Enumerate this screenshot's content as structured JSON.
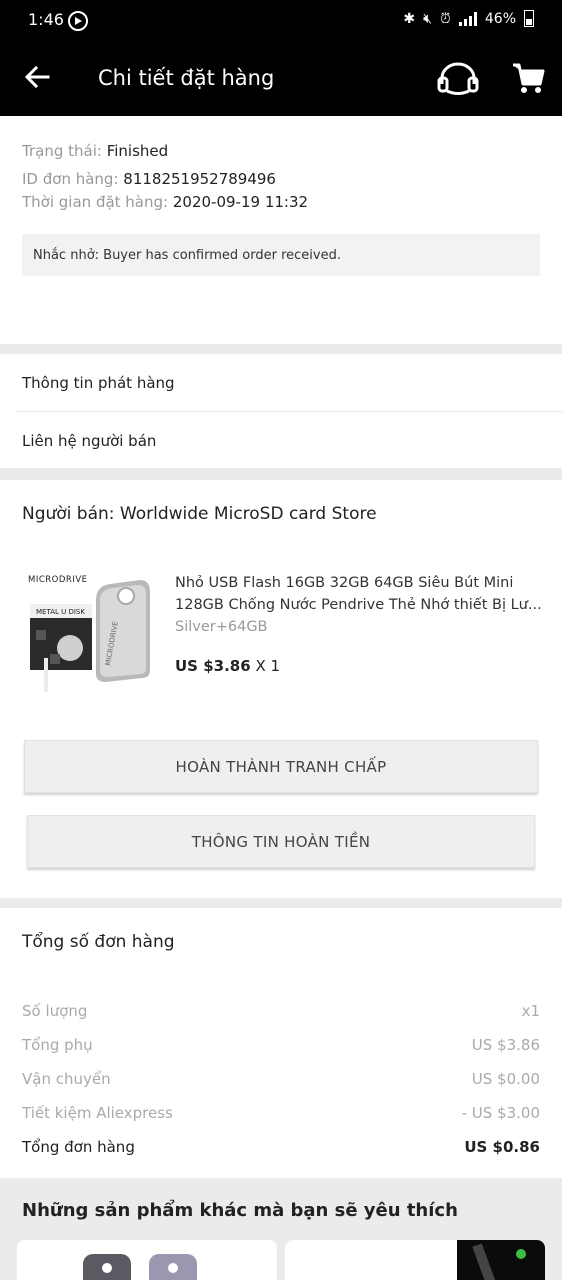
{
  "status_bar": {
    "time": "1:46",
    "battery": "46%"
  },
  "app_bar": {
    "title": "Chi tiết đặt hàng",
    "icons": [
      "back-arrow-icon",
      "headset-support-icon",
      "cart-icon"
    ]
  },
  "order": {
    "status_label": "Trạng thái:",
    "status_value": "Finished",
    "id_label": "ID đơn hàng:",
    "id_value": "8118251952789496",
    "time_label": "Thời gian đặt hàng:",
    "time_value": "2020-09-19 11:32",
    "notice": "Nhắc nhở: Buyer has confirmed order received."
  },
  "links": {
    "shipping_info": "Thông tin phát hàng",
    "contact_seller": "Liên hệ người bán"
  },
  "seller": {
    "label": "Người bán: Worldwide MicroSD card Store"
  },
  "product": {
    "title_line1": "Nhỏ USB Flash 16GB 32GB 64GB Siêu Bút Mini",
    "title_line2": "128GB Chống Nước Pendrive Thẻ Nhớ thiết Bị Lư...",
    "variant": "Silver+64GB",
    "price": "US $3.86",
    "quantity": "X 1",
    "image_brand": "MICRODRIVE",
    "image_caption": "METAL U DISK"
  },
  "buttons": {
    "dispute": "HOÀN THÀNH TRANH CHẤP",
    "refund_info": "THÔNG TIN HOÀN TIỀN"
  },
  "summary": {
    "title": "Tổng số đơn hàng",
    "rows": [
      {
        "label": "Số lượng",
        "value": "x1"
      },
      {
        "label": "Tổng phụ",
        "value": "US $3.86"
      },
      {
        "label": "Vận chuyển",
        "value": "US $0.00"
      },
      {
        "label": "Tiết kiệm Aliexpress",
        "value": "- US $3.00"
      },
      {
        "label": "Tổng đơn hàng",
        "value": "US $0.86"
      }
    ]
  },
  "recommendations": {
    "title": "Những sản phẩm khác mà bạn sẽ yêu thích"
  }
}
